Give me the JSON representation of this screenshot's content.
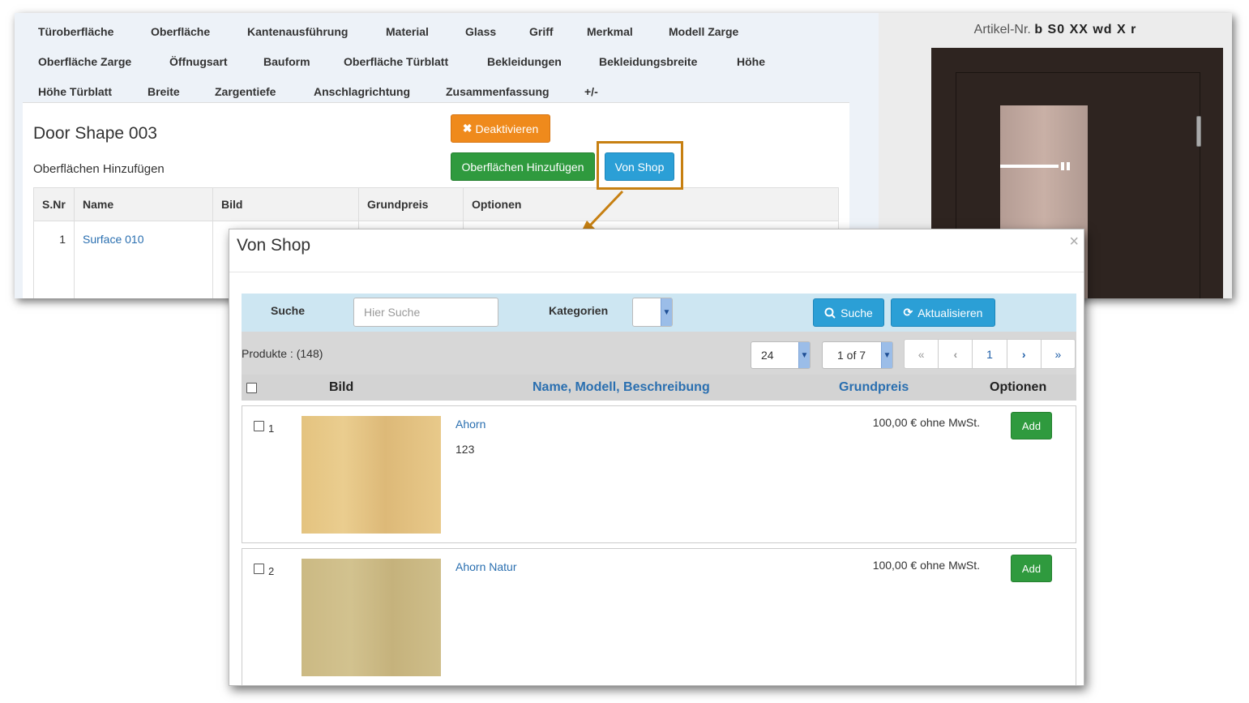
{
  "nav_tabs": [
    "Türoberfläche",
    "Oberfläche",
    "Kantenausführung",
    "Material",
    "Glass",
    "Griff",
    "Merkmal",
    "Modell Zarge",
    "Oberfläche Zarge",
    "Öffnugsart",
    "Bauform",
    "Oberfläche Türblatt",
    "Bekleidungen",
    "Bekleidungsbreite",
    "Höhe",
    "Höhe Türblatt",
    "Breite",
    "Zargentiefe",
    "Anschlagrichtung",
    "Zusammenfassung",
    "+/-"
  ],
  "main": {
    "title": "Door Shape 003",
    "subtitle": "Oberflächen Hinzufügen",
    "deactivate_label": "Deaktivieren",
    "add_surfaces_label": "Oberflächen Hinzufügen",
    "from_shop_label": "Von Shop",
    "table_headers": [
      "S.Nr",
      "Name",
      "Bild",
      "Grundpreis",
      "Optionen"
    ],
    "rows": [
      {
        "nr": "1",
        "name": "Surface 010"
      }
    ]
  },
  "preview": {
    "artikel_label": "Artikel-Nr.",
    "artikel_value": "b S0 XX wd X r"
  },
  "modal": {
    "title": "Von Shop",
    "close": "×",
    "search_label": "Suche",
    "search_placeholder": "Hier Suche",
    "categories_label": "Kategorien",
    "search_button": "Suche",
    "refresh_button": "Aktualisieren",
    "products_count": "Produkte : (148)",
    "per_page": "24",
    "page_of": "1 of 7",
    "current_page": "1",
    "headers": {
      "image": "Bild",
      "name": "Name",
      "model": "Modell",
      "description": "Beschreibung",
      "price": "Grundpreis",
      "options": "Optionen"
    },
    "products": [
      {
        "nr": "1",
        "name": "Ahorn",
        "description": "123",
        "price": "100,00 € ohne MwSt.",
        "add": "Add",
        "color": "#e4c37f"
      },
      {
        "nr": "2",
        "name": "Ahorn Natur",
        "description": "",
        "price": "100,00 € ohne MwSt.",
        "add": "Add",
        "color": "#cbb983"
      }
    ]
  },
  "colors": {
    "orange": "#ef8a1c",
    "green": "#2f9a3e",
    "blue": "#2b9fd6",
    "highlight": "#c78012"
  }
}
